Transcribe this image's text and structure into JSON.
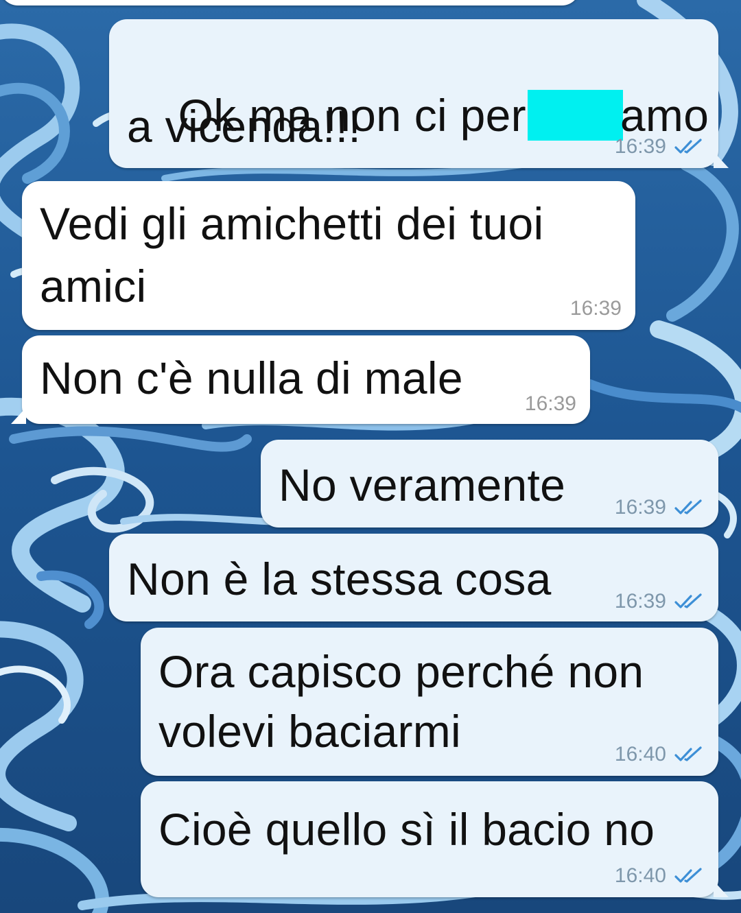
{
  "colors": {
    "outgoing_bubble": "#e9f3fb",
    "incoming_bubble": "#ffffff",
    "read_ticks": "#3d8fd6",
    "redaction": "#00f0f0",
    "wallpaper_dark": "#1a4f86",
    "wallpaper_light": "#b9d9f0"
  },
  "icons": {
    "read_receipt": "double-check-icon"
  },
  "messages": [
    {
      "direction": "outgoing",
      "line1_before": "Ok ma non ci per",
      "line1_after": "amo",
      "line2": "a vicenda!!!",
      "time": "16:39",
      "status": "read"
    },
    {
      "direction": "incoming",
      "line1": "Vedi gli amichetti dei tuoi",
      "line2": "amici",
      "time": "16:39"
    },
    {
      "direction": "incoming",
      "line1": "Non c'è nulla di male",
      "time": "16:39"
    },
    {
      "direction": "outgoing",
      "line1": "No veramente",
      "time": "16:39",
      "status": "read"
    },
    {
      "direction": "outgoing",
      "line1": "Non è la stessa cosa",
      "time": "16:39",
      "status": "read"
    },
    {
      "direction": "outgoing",
      "line1": "Ora capisco perché non",
      "line2": "volevi baciarmi",
      "time": "16:40",
      "status": "read"
    },
    {
      "direction": "outgoing",
      "line1": "Cioè quello sì il bacio no",
      "time": "16:40",
      "status": "read"
    }
  ]
}
